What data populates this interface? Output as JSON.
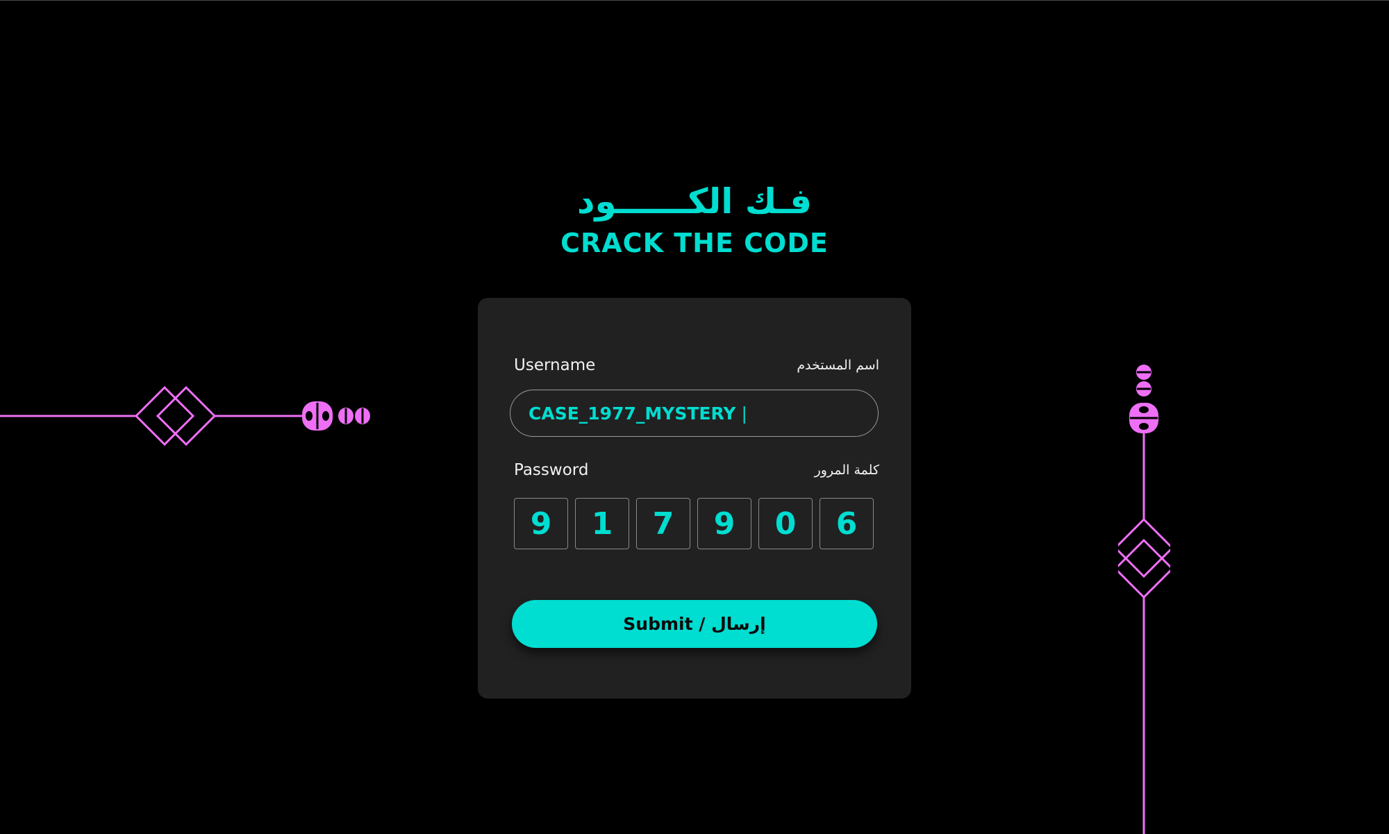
{
  "header": {
    "title_arabic": "فـك الكــــــود",
    "title_english": "CRACK THE CODE"
  },
  "form": {
    "username": {
      "label_en": "Username",
      "label_ar": "اسم المستخدم",
      "value": "CASE_1977_MYSTERY",
      "cursor": "|"
    },
    "password": {
      "label_en": "Password",
      "label_ar": "كلمة المرور",
      "digits": [
        "9",
        "1",
        "7",
        "9",
        "0",
        "6"
      ]
    },
    "submit_label": "Submit / إرسال"
  },
  "colors": {
    "background": "#000000",
    "card": "#212121",
    "accent_teal": "#00ddd1",
    "decor_magenta": "#ee6ff5",
    "text_light": "#f2f2f2"
  },
  "icons": {
    "left_decoration": "diamond-line-ornament-horizontal",
    "right_decoration": "diamond-line-ornament-vertical"
  }
}
